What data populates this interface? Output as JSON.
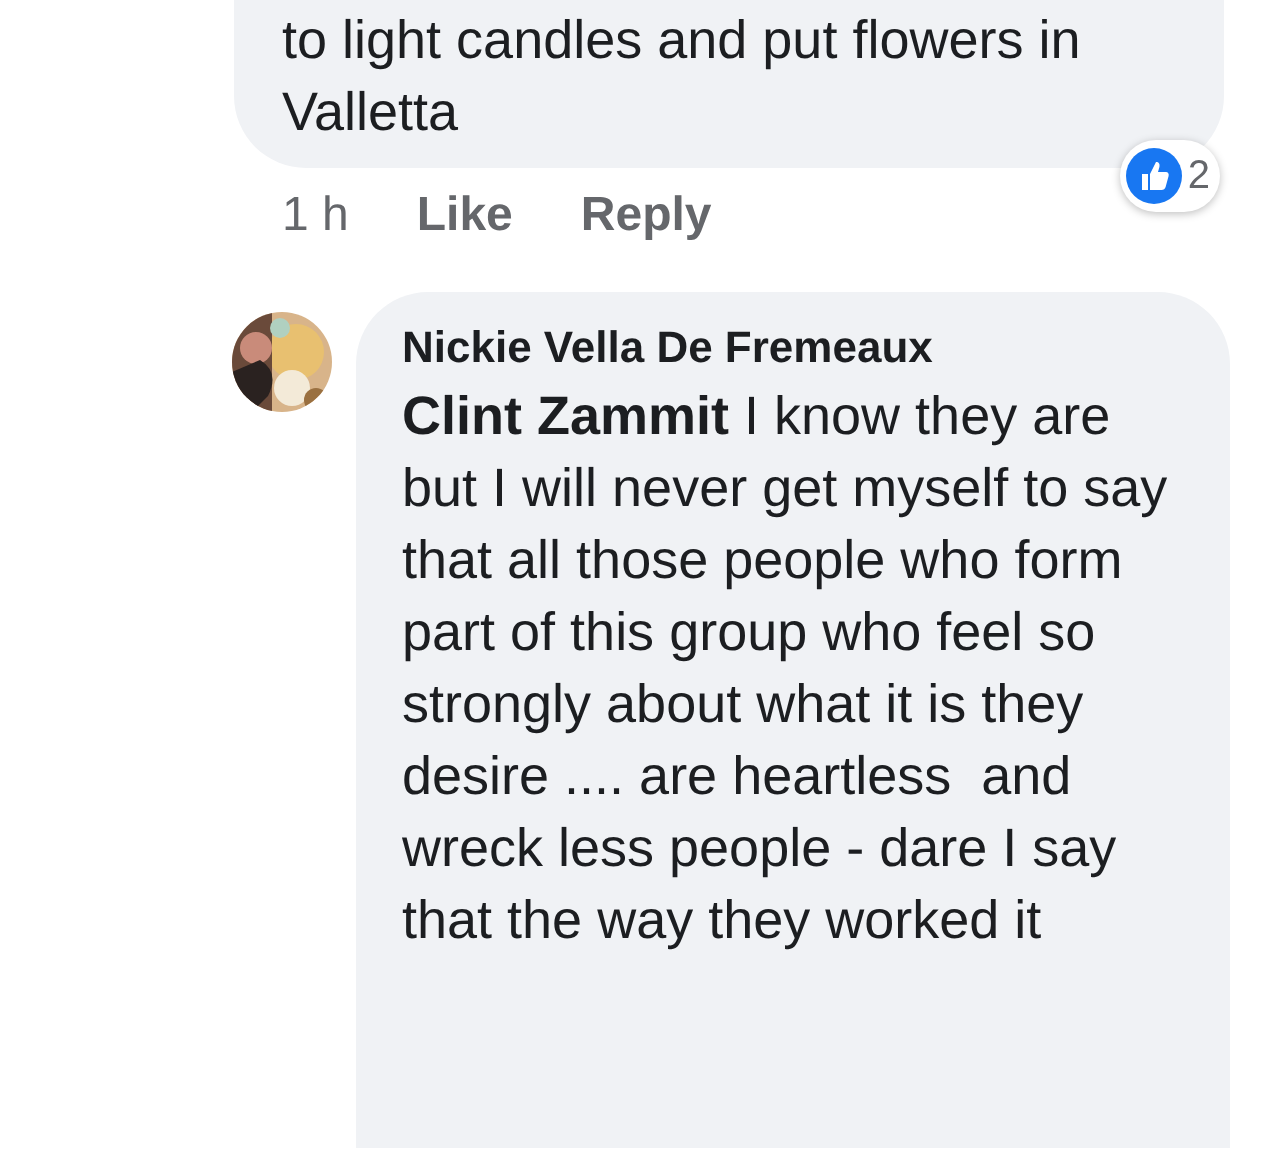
{
  "comments": [
    {
      "text": "to light candles and put flowers in Valletta",
      "time": "1 h",
      "actions": [
        "Like",
        "Reply"
      ],
      "reactions": {
        "count": "2"
      }
    },
    {
      "author": "Nickie Vella De Fremeaux",
      "text": "**Clint Zammit** I know they are but I will never get myself to say that all those people who form part of this group who feel so strongly about what it is they desire .... are heartless  and wreck less people - dare I say that the way they worked it"
    }
  ]
}
